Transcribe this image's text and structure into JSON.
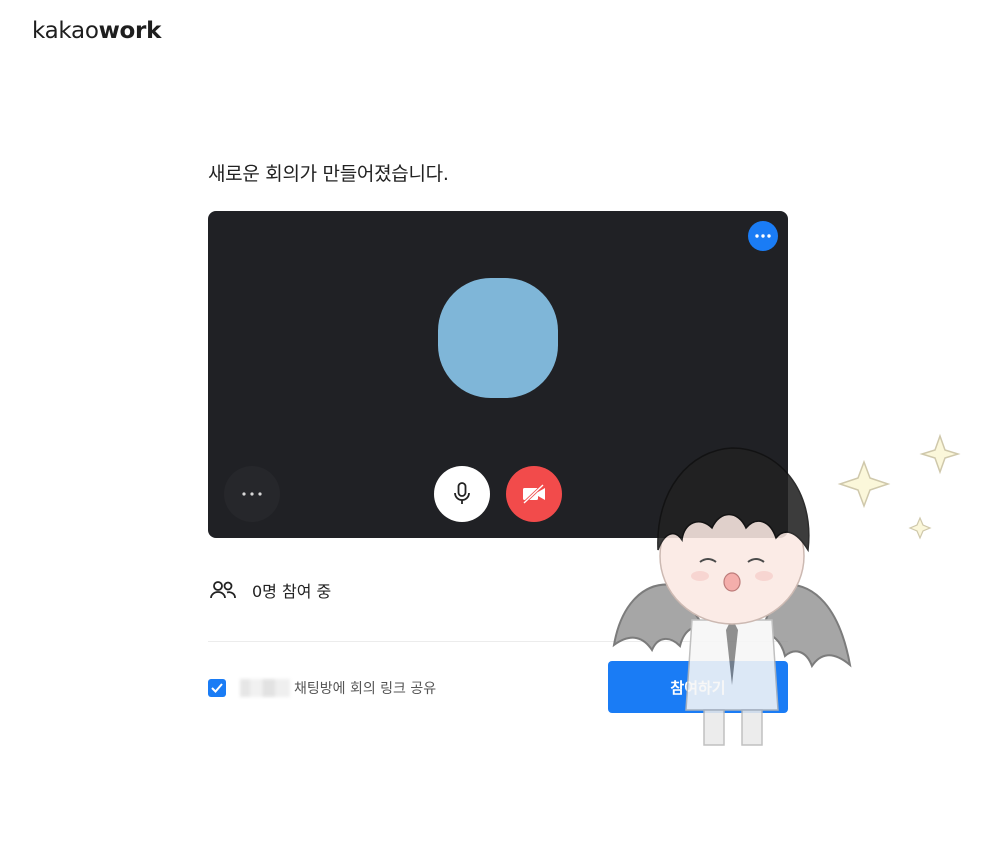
{
  "brand": {
    "logo_light": "kakao",
    "logo_bold": "work"
  },
  "headline": "새로운 회의가 만들어졌습니다.",
  "preview": {
    "more_icon": "more-horizontal-icon",
    "avatar_color": "#7fb6d8",
    "controls": {
      "more_icon": "more-horizontal-icon",
      "mic_icon": "microphone-icon",
      "camera_icon": "camera-off-icon"
    }
  },
  "participants": {
    "icon": "people-icon",
    "label": "0명 참여 중"
  },
  "share": {
    "checked": true,
    "label": "채팅방에 회의 링크 공유"
  },
  "join_button": {
    "label": "참여하기"
  },
  "colors": {
    "accent": "#1a7cf5",
    "preview_bg": "#202125",
    "camera_off": "#f24b4b"
  }
}
